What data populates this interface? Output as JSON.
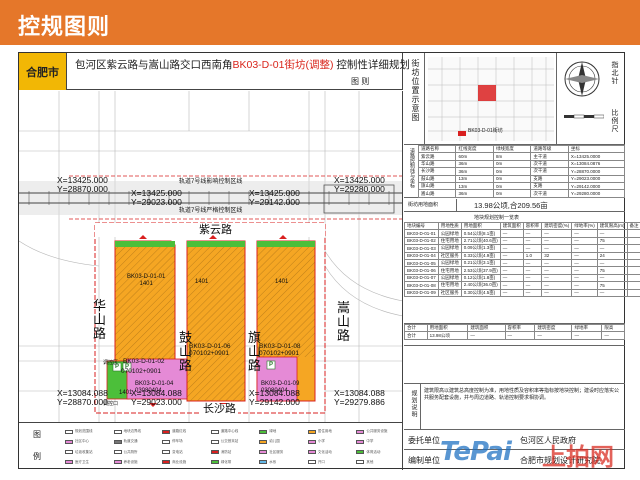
{
  "header": {
    "title": "控规图则",
    "bg_color": "#e5772a"
  },
  "sheet": {
    "city": "合肥市",
    "title_prefix": "包河区紫云路与嵩山路交口西南角",
    "title_highlight": "BK03-D-01街坊(调整)",
    "title_suffix": " 控制性详细规划",
    "subtitle": "图    则"
  },
  "map": {
    "coords": [
      {
        "x": "X=13425.000",
        "y": "Y=28870.000"
      },
      {
        "x": "X=13425.000",
        "y": "Y=29023.000"
      },
      {
        "x": "X=13425.000",
        "y": "Y=29142.000"
      },
      {
        "x": "X=13425.000",
        "y": "Y=29280.000"
      },
      {
        "x": "X=13084.088",
        "y": "Y=28870.000"
      },
      {
        "x": "X=13084.088",
        "y": "Y=29023.000"
      },
      {
        "x": "X=13084.088",
        "y": "Y=29142.000"
      },
      {
        "x": "X=13084.088",
        "y": "Y=29279.886"
      }
    ],
    "metro_line_1": "轨道7号线影响控制区线",
    "metro_line_2": "轨道7号线严格控制区线",
    "roads": {
      "north": "紫云路",
      "south": "长沙路",
      "west": "华山路",
      "east": "嵩山路",
      "mid1": "鼓山路",
      "mid2": "旗山路"
    },
    "parcels": [
      {
        "id": "BK03-D-01-01",
        "code": "1401"
      },
      {
        "id": "BK03-D-01-02",
        "code": "070102+0901"
      },
      {
        "id": "BK03-D-01-03",
        "code": "1401"
      },
      {
        "id": "BK03-D-01-04",
        "code": "03080404"
      },
      {
        "id": "BK03-D-01-05",
        "code": "1401"
      },
      {
        "id": "BK03-D-01-06",
        "code": "070102+0901"
      },
      {
        "id": "BK03-D-01-07",
        "code": "1401"
      },
      {
        "id": "BK03-D-01-08",
        "code": "070102+0901"
      },
      {
        "id": "BK03-D-01-09",
        "code": "03080404"
      }
    ],
    "small_labels": {
      "bus_stop": "调控区",
      "station_1": "调控口",
      "parking": "P"
    },
    "colors": {
      "residential": "#f5a623",
      "public": "#e58ad6",
      "green": "#4cbf3a",
      "redline": "#d92020",
      "rail": "#444444"
    }
  },
  "legend": {
    "label_1": "图",
    "label_2": "例",
    "items": [
      {
        "text": "规划范围线",
        "color": "#ffffff"
      },
      {
        "text": "地块边界线",
        "color": "#ffffff"
      },
      {
        "text": "道路红线",
        "color": "#d92020"
      },
      {
        "text": "道路中心线",
        "color": "#ffffff"
      },
      {
        "text": "绿地",
        "color": "#4cbf3a"
      },
      {
        "text": "居住用地",
        "color": "#f5a623"
      },
      {
        "text": "公共服务设施",
        "color": "#e58ad6"
      },
      {
        "text": "社区中心",
        "color": "#e58ad6"
      },
      {
        "text": "轨道交通",
        "color": "#777777"
      },
      {
        "text": "停车场",
        "color": "#ffffff"
      },
      {
        "text": "公交首末站",
        "color": "#ffffff"
      },
      {
        "text": "幼儿园",
        "color": "#f5a623"
      },
      {
        "text": "小学",
        "color": "#e58ad6"
      },
      {
        "text": "中学",
        "color": "#e58ad6"
      },
      {
        "text": "垃圾收集站",
        "color": "#ffffff"
      },
      {
        "text": "公共厕所",
        "color": "#ffffff"
      },
      {
        "text": "变电站",
        "color": "#ffffff"
      },
      {
        "text": "消防站",
        "color": "#d92020"
      },
      {
        "text": "社区服务",
        "color": "#e58ad6"
      },
      {
        "text": "文化活动",
        "color": "#e58ad6"
      },
      {
        "text": "体育活动",
        "color": "#4cbf3a"
      },
      {
        "text": "医疗卫生",
        "color": "#e58ad6"
      },
      {
        "text": "养老设施",
        "color": "#e58ad6"
      },
      {
        "text": "商业设施",
        "color": "#d92020"
      },
      {
        "text": "绿化带",
        "color": "#4cbf3a"
      },
      {
        "text": "水系",
        "color": "#63b7e6"
      },
      {
        "text": "开口",
        "color": "#ffffff"
      },
      {
        "text": "其他",
        "color": "#ffffff"
      }
    ]
  },
  "right_panel": {
    "location_label": "街坊位置示意图",
    "north_label": "指北针",
    "scale_label": "比例尺",
    "plot_legend": "BK03-D-01街坊",
    "road_table_label": "道路控制线与坐标",
    "road_headers": [
      "道路名称",
      "红线宽度",
      "绿线宽度",
      "道路等级",
      "坐标"
    ],
    "roads": [
      {
        "name": "紫云路",
        "red": "60m",
        "green": "8m",
        "grade": "主干道",
        "coord": "X=13425.0000"
      },
      {
        "name": "华山路",
        "red": "36m",
        "green": "0m",
        "grade": "次干道",
        "coord": "X=13084.0876"
      },
      {
        "name": "长沙路",
        "red": "36m",
        "green": "0m",
        "grade": "次干道",
        "coord": "Y=28870.0000"
      },
      {
        "name": "鼓山路",
        "red": "13m",
        "green": "0m",
        "grade": "支路",
        "coord": "Y=29023.0000"
      },
      {
        "name": "旗山路",
        "red": "13m",
        "green": "0m",
        "grade": "支路",
        "coord": "Y=29142.0000"
      },
      {
        "name": "嵩山路",
        "red": "36m",
        "green": "0m",
        "grade": "次干道",
        "coord": "Y=29280.0000"
      }
    ],
    "area_label": "街坊用地面积",
    "area_value": "13.98公顷,合209.56亩",
    "plot_table_title": "地块规划控制一览表",
    "plot_headers": [
      "地块编号",
      "用地性质",
      "用地面积",
      "建筑面积",
      "容积率",
      "建筑密度(%)",
      "绿地率(%)",
      "建筑限高(m)",
      "备注"
    ],
    "plots": [
      {
        "id": "BK03-D-01-01",
        "use": "公园绿地",
        "area": "0.54公顷(8.1亩)",
        "ba": "—",
        "far": "—",
        "den": "—",
        "gr": "—",
        "h": "—",
        "note": ""
      },
      {
        "id": "BK03-D-01-02",
        "use": "住宅用地",
        "area": "2.71公顷(40.6亩)",
        "ba": "—",
        "far": "—",
        "den": "—",
        "gr": "—",
        "h": "75",
        "note": ""
      },
      {
        "id": "BK03-D-01-03",
        "use": "公园绿地",
        "area": "0.09公顷(1.3亩)",
        "ba": "—",
        "far": "—",
        "den": "—",
        "gr": "—",
        "h": "—",
        "note": ""
      },
      {
        "id": "BK03-D-01-04",
        "use": "社区服务",
        "area": "0.33公顷(4.9亩)",
        "ba": "—",
        "far": "1.0",
        "den": "32",
        "gr": "—",
        "h": "24",
        "note": ""
      },
      {
        "id": "BK03-D-01-05",
        "use": "公园绿地",
        "area": "0.21公顷(3.1亩)",
        "ba": "—",
        "far": "—",
        "den": "—",
        "gr": "—",
        "h": "—",
        "note": ""
      },
      {
        "id": "BK03-D-01-06",
        "use": "住宅用地",
        "area": "2.53公顷(37.9亩)",
        "ba": "—",
        "far": "—",
        "den": "—",
        "gr": "—",
        "h": "75",
        "note": ""
      },
      {
        "id": "BK03-D-01-07",
        "use": "公园绿地",
        "area": "0.12公顷(1.8亩)",
        "ba": "—",
        "far": "—",
        "den": "—",
        "gr": "—",
        "h": "—",
        "note": ""
      },
      {
        "id": "BK03-D-01-08",
        "use": "住宅用地",
        "area": "2.40公顷(36.0亩)",
        "ba": "—",
        "far": "—",
        "den": "—",
        "gr": "—",
        "h": "75",
        "note": ""
      },
      {
        "id": "BK03-D-01-09",
        "use": "社区服务",
        "area": "0.30公顷(4.5亩)",
        "ba": "—",
        "far": "—",
        "den": "—",
        "gr": "—",
        "h": "—",
        "note": ""
      }
    ],
    "totals_headers": [
      "合计",
      "用地面积",
      "建筑面积",
      "容积率",
      "建筑密度",
      "绿地率",
      "限高"
    ],
    "totals": [
      "合计",
      "13.98公顷",
      "—",
      "—",
      "—",
      "—",
      "—"
    ],
    "notes_label": "规划说明",
    "notes_text": "建筑限高以建筑总高度控制为准，用地性质及容积率等指标按地块控制；建设时应落实公共服务配套设施，并与周边道路、轨道控制要求相协调。",
    "unit_label": "委托单位",
    "unit_value": "包河区人民政府",
    "compiler_label": "编制单位",
    "compiler_value": "合肥市规划设计研究院",
    "watermark_1": "TePai",
    "watermark_2": "上拍网"
  }
}
